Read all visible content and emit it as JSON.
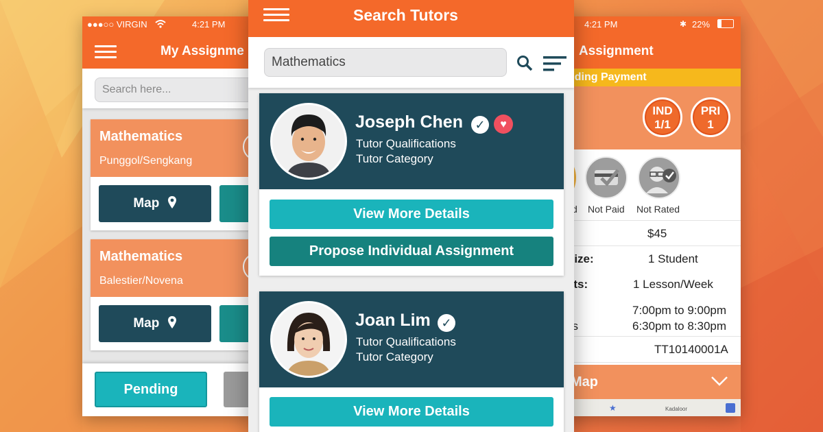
{
  "left_phone": {
    "status": {
      "carrier": "●●●○○ VIRGIN",
      "time": "4:21 PM"
    },
    "title": "My Assignme",
    "search": {
      "placeholder": "Search here..."
    },
    "assignments": [
      {
        "subject": "Mathematics",
        "location": "Punggol/Sengkang",
        "map_label": "Map"
      },
      {
        "subject": "Mathematics",
        "location": "Balestier/Novena",
        "map_label": "Map"
      }
    ],
    "bottom_tabs": [
      {
        "label": "Pending",
        "active": true
      },
      {
        "label": "",
        "active": false
      }
    ]
  },
  "center_phone": {
    "title": "Search Tutors",
    "search": {
      "value": "Mathematics"
    },
    "tutors": [
      {
        "name": "Joseph Chen",
        "qualifications": "Tutor Qualifications",
        "category": "Tutor Category",
        "verified": true,
        "favorite": true,
        "buttons": {
          "details": "View More Details",
          "propose": "Propose Individual Assignment"
        }
      },
      {
        "name": "Joan Lim",
        "qualifications": "Tutor Qualifications",
        "category": "Tutor Category",
        "verified": true,
        "favorite": false,
        "buttons": {
          "details": "View More Details"
        }
      }
    ]
  },
  "right_phone": {
    "status": {
      "time": "4:21 PM",
      "battery": "22%"
    },
    "title": "Assignment",
    "pending_banner": "nding Payment",
    "header_fragment": "g",
    "badges": [
      {
        "line1": "IND",
        "line2": "1/1"
      },
      {
        "line1": "PRI",
        "line2": "1"
      }
    ],
    "status_icons": [
      {
        "label": "d"
      },
      {
        "label": "Not Paid"
      },
      {
        "label": "Not Rated"
      }
    ],
    "details": [
      {
        "key": ":",
        "value": "$45"
      },
      {
        "key": "Size:",
        "value": "1 Student"
      },
      {
        "key": "ots:",
        "value": "1 Lesson/Week"
      },
      {
        "key": "s\nys",
        "value1": "7:00pm to 9:00pm",
        "value2": "6:30pm to 8:30pm"
      },
      {
        "key": "",
        "value": "TT10140001A"
      }
    ],
    "map_label": "Map",
    "map_place": "Kadaloor"
  },
  "colors": {
    "orange": "#f4692a",
    "peach": "#f2915d",
    "navy": "#1f4a5a",
    "teal": "#1ab4bb",
    "teal_dark": "#16827e",
    "yellow": "#f6b81c"
  }
}
